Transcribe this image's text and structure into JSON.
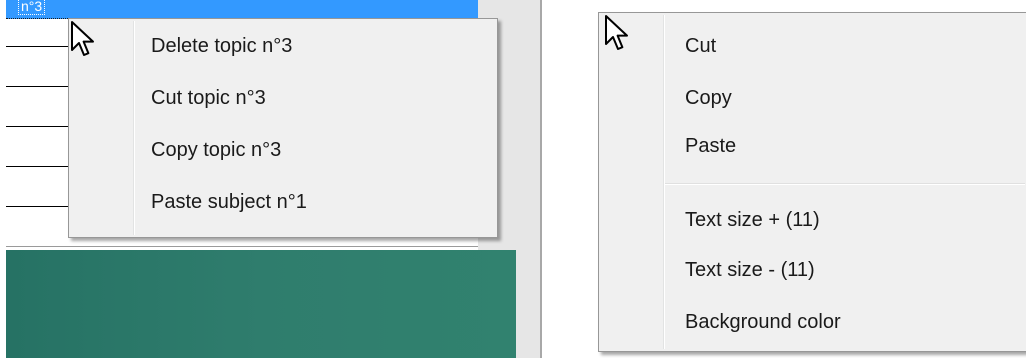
{
  "left": {
    "selected_row_text": "n°3",
    "context_menu": {
      "items": [
        {
          "label": "Delete topic n°3"
        },
        {
          "label": "Cut topic  n°3"
        },
        {
          "label": "Copy topic  n°3"
        },
        {
          "label": "Paste subject  n°1"
        }
      ]
    }
  },
  "right": {
    "context_menu": {
      "items": [
        {
          "label": "Cut"
        },
        {
          "label": "Copy"
        },
        {
          "label": "Paste"
        },
        {
          "label": "Text size + (11)"
        },
        {
          "label": "Text size - (11)"
        },
        {
          "label": "Background color"
        }
      ]
    }
  },
  "colors": {
    "selection": "#3399ff",
    "teal": "#2d7a6a",
    "menu_bg": "#f0f0f0"
  },
  "icons": {
    "cursor": "arrow-pointer-icon"
  }
}
